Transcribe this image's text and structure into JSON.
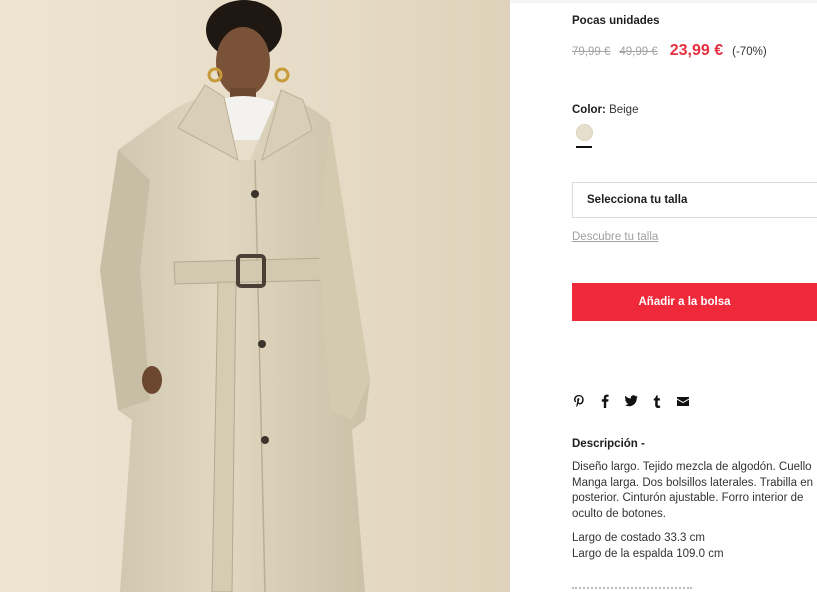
{
  "product": {
    "stock_label": "Pocas unidades",
    "prices": {
      "original": "79,99 €",
      "previous": "49,99 €",
      "current": "23,99 €",
      "discount": "(-70%)"
    },
    "color": {
      "label": "Color:",
      "value": "Beige",
      "swatch_hex": "#e6dfcd"
    },
    "size_select": "Selecciona tu talla",
    "size_guide_link": "Descubre tu talla",
    "add_to_bag": "Añadir a la bolsa",
    "share_icons": [
      "pinterest-icon",
      "facebook-icon",
      "twitter-icon",
      "tumblr-icon",
      "email-icon"
    ],
    "description": {
      "title": "Descripción -",
      "body": "Diseño largo. Tejido mezcla de algodón. Cuello\nManga larga. Dos bolsillos laterales. Trabilla en\nposterior. Cinturón ajustable. Forro interior de\noculto de botones.",
      "measure_1": "Largo de costado 33.3 cm",
      "measure_2": "Largo de la espalda 109.0 cm"
    }
  },
  "colors": {
    "accent": "#f0293a",
    "sale_price": "#e5303f"
  }
}
